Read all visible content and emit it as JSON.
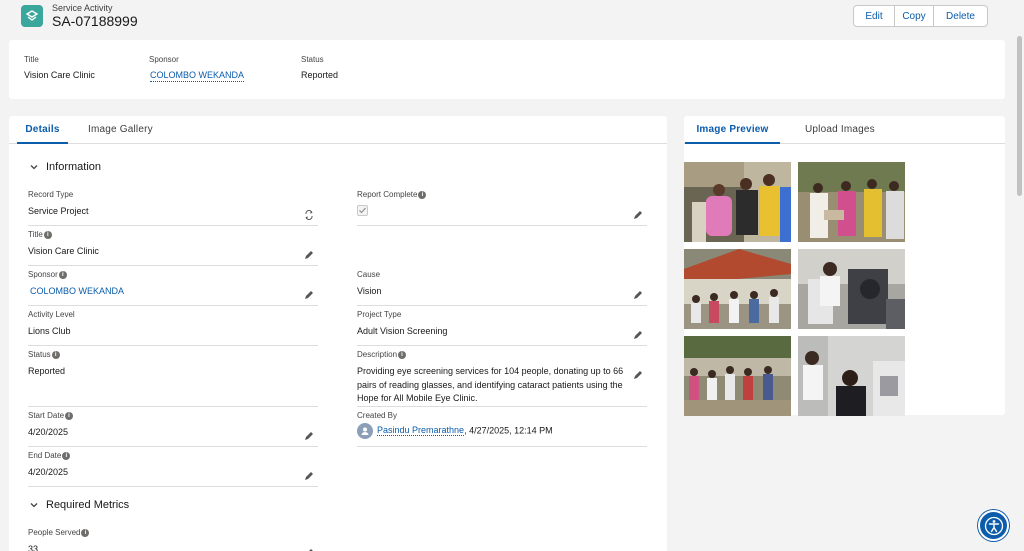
{
  "header": {
    "record_type": "Service Activity",
    "record_number": "SA-07188999",
    "icon": "service-activity-icon",
    "buttons": {
      "edit": "Edit",
      "copy": "Copy",
      "delete": "Delete"
    }
  },
  "highlights": [
    {
      "label": "Title",
      "value": "Vision Care Clinic"
    },
    {
      "label": "Sponsor",
      "value": "COLOMBO WEKANDA"
    },
    {
      "label": "Status",
      "value": "Reported"
    }
  ],
  "left_tabs": [
    "Details",
    "Image Gallery"
  ],
  "sections": {
    "information": "Information",
    "required_metrics": "Required Metrics"
  },
  "fields": {
    "record_type": {
      "label": "Record Type",
      "value": "Service Project"
    },
    "report_complete": {
      "label": "Report Complete",
      "checked": true
    },
    "title": {
      "label": "Title",
      "value": "Vision Care Clinic"
    },
    "sponsor": {
      "label": "Sponsor",
      "value": "COLOMBO WEKANDA"
    },
    "cause": {
      "label": "Cause",
      "value": "Vision"
    },
    "activity_level": {
      "label": "Activity Level",
      "value": "Lions Club"
    },
    "project_type": {
      "label": "Project Type",
      "value": "Adult Vision Screening"
    },
    "status": {
      "label": "Status",
      "value": "Reported"
    },
    "description": {
      "label": "Description",
      "value": "Providing eye screening services for 104 people, donating up to 66 pairs of reading glasses, and identifying cataract patients using the Hope for All Mobile Eye Clinic."
    },
    "start_date": {
      "label": "Start Date",
      "value": "4/20/2025"
    },
    "created_by": {
      "label": "Created By",
      "user": "Pasindu Premarathne",
      "timestamp": ", 4/27/2025, 12:14 PM"
    },
    "end_date": {
      "label": "End Date",
      "value": "4/20/2025"
    },
    "people_served": {
      "label": "People Served",
      "value": "33"
    }
  },
  "right_tabs": [
    "Image Preview",
    "Upload Images"
  ],
  "colors": {
    "brand": "#0b5cab",
    "record_icon": "#3ba79c"
  }
}
